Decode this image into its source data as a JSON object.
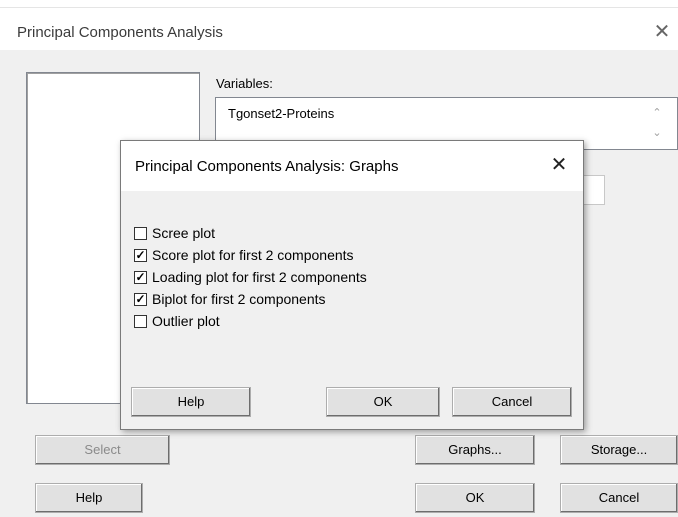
{
  "main": {
    "title": "Principal Components Analysis",
    "variables_label": "Variables:",
    "variables_value": "Tgonset2-Proteins",
    "buttons": {
      "select": "Select",
      "help": "Help",
      "graphs": "Graphs...",
      "storage": "Storage...",
      "ok": "OK",
      "cancel": "Cancel"
    }
  },
  "graphs_dialog": {
    "title": "Principal Components Analysis: Graphs",
    "options": [
      {
        "label": "Scree plot",
        "checked": false
      },
      {
        "label": "Score plot for first 2 components",
        "checked": true
      },
      {
        "label": "Loading plot for first 2 components",
        "checked": true
      },
      {
        "label": "Biplot for first 2 components",
        "checked": true
      },
      {
        "label": "Outlier plot",
        "checked": false
      }
    ],
    "buttons": {
      "help": "Help",
      "ok": "OK",
      "cancel": "Cancel"
    }
  },
  "icons": {
    "close": "close-icon",
    "scroll_up": "chevron-up-icon",
    "scroll_down": "chevron-down-icon"
  }
}
